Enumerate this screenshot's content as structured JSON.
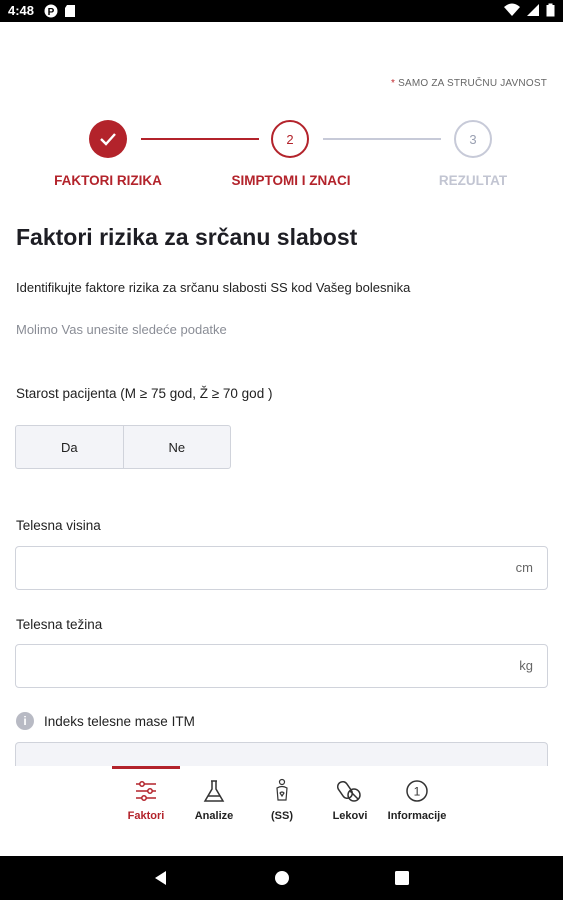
{
  "status_bar": {
    "time": "4:48"
  },
  "note": {
    "star": "*",
    "text": "SAMO ZA STRUČNU JAVNOST"
  },
  "stepper": {
    "steps": [
      {
        "label": "FAKTORI RIZIKA",
        "number": "",
        "state": "done"
      },
      {
        "label": "SIMPTOMI I ZNACI",
        "number": "2",
        "state": "current"
      },
      {
        "label": "REZULTAT",
        "number": "3",
        "state": "upcoming"
      }
    ]
  },
  "page": {
    "title": "Faktori rizika za srčanu slabost",
    "subtitle": "Identifikujte faktore rizika za srčanu slabosti SS kod Vašeg bolesnika",
    "hint": "Molimo Vas unesite sledeće podatke"
  },
  "age_question": {
    "label": "Starost pacijenta (M ≥ 75 god, Ž ≥ 70 god )",
    "options": [
      "Da",
      "Ne"
    ]
  },
  "height": {
    "label": "Telesna visina",
    "value": "",
    "unit": "cm"
  },
  "weight": {
    "label": "Telesna težina",
    "value": "",
    "unit": "kg"
  },
  "bmi": {
    "info_icon": "i",
    "label": "Indeks telesne mase ITM"
  },
  "bottom_nav": {
    "items": [
      {
        "label": "Faktori",
        "icon": "sliders-icon",
        "active": true
      },
      {
        "label": "Analize",
        "icon": "flask-icon",
        "active": false
      },
      {
        "label": "(SS)",
        "icon": "heart-body-icon",
        "active": false
      },
      {
        "label": "Lekovi",
        "icon": "pills-icon",
        "active": false
      },
      {
        "label": "Informacije",
        "icon": "info-circle-icon",
        "active": false
      }
    ]
  },
  "colors": {
    "accent": "#b3232b",
    "inactive_step": "#c7cad8",
    "field_border": "#d0d3db"
  }
}
